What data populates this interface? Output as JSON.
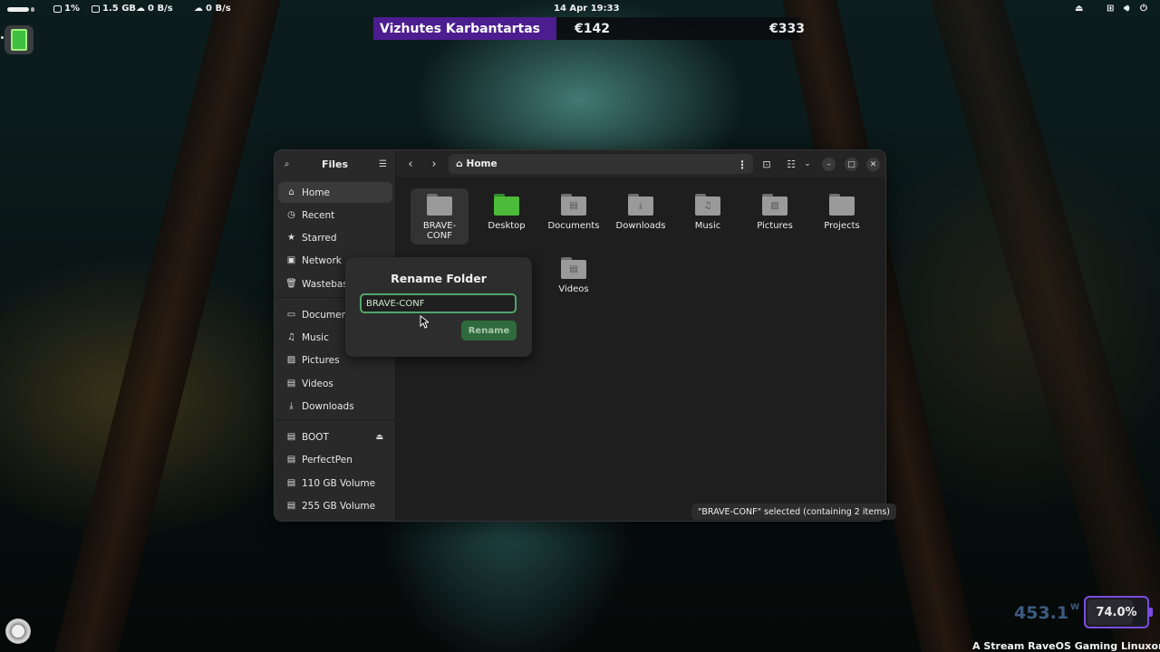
{
  "topbar": {
    "cpu": "1%",
    "memory": "1.5 GB",
    "net_up": "0 B/s",
    "net_down": "0 B/s",
    "datetime": "14 Apr  19:33"
  },
  "ticker": {
    "name": "Vizhutes Karbantartas",
    "price1": "€142",
    "price2": "€333"
  },
  "sidebar": {
    "title": "Files",
    "places": [
      {
        "label": "Home",
        "icon": "home-icon"
      },
      {
        "label": "Recent",
        "icon": "clock-icon"
      },
      {
        "label": "Starred",
        "icon": "star-icon"
      },
      {
        "label": "Network",
        "icon": "network-icon"
      },
      {
        "label": "Wastebasket",
        "icon": "trash-icon"
      }
    ],
    "bookmarks": [
      {
        "label": "Documents",
        "icon": "document-icon"
      },
      {
        "label": "Music",
        "icon": "music-icon"
      },
      {
        "label": "Pictures",
        "icon": "picture-icon"
      },
      {
        "label": "Videos",
        "icon": "video-icon"
      },
      {
        "label": "Downloads",
        "icon": "download-icon"
      }
    ],
    "devices": [
      {
        "label": "BOOT",
        "icon": "drive-icon"
      },
      {
        "label": "PerfectPen",
        "icon": "drive-icon"
      },
      {
        "label": "110 GB Volume",
        "icon": "drive-icon"
      },
      {
        "label": "255 GB Volume",
        "icon": "drive-icon"
      }
    ]
  },
  "header": {
    "path": "Home"
  },
  "files": [
    {
      "name": "BRAVE-\nCONF",
      "selected": true
    },
    {
      "name": "Desktop"
    },
    {
      "name": "Documents"
    },
    {
      "name": "Downloads"
    },
    {
      "name": "Music"
    },
    {
      "name": "Pictures"
    },
    {
      "name": "Projects"
    },
    {
      "name": "Videos"
    }
  ],
  "rename": {
    "title": "Rename Folder",
    "value": "BRAVE-CONF",
    "button": "Rename"
  },
  "status": "\"BRAVE-CONF\" selected  (containing 2 items)",
  "widgets": {
    "watts": "453.1",
    "watts_unit": "W",
    "battery": "74.0%",
    "marquee": "A Stream RaveOS Gaming Linuxon fut"
  }
}
